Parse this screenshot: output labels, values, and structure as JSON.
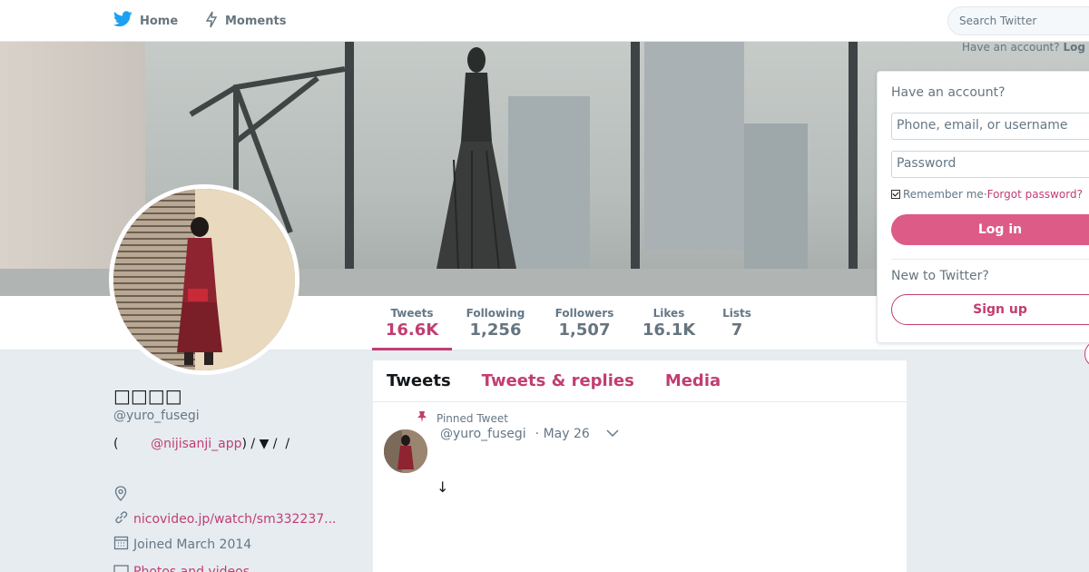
{
  "nav": {
    "home_label": "Home",
    "moments_label": "Moments",
    "search_placeholder": "Search Twitter",
    "have_account_text": "Have an account?",
    "login_link": "Log"
  },
  "profile": {
    "name": "□□□□",
    "handle": "@yuro_fusegi",
    "bio_prefix": "(        ",
    "bio_mention": "@nijisanji_app",
    "bio_suffix": ") / ▼ /  /",
    "location": "",
    "url": "nicovideo.jp/watch/sm332237...",
    "joined": "Joined March 2014",
    "photos_videos": "Photos and videos"
  },
  "stats": [
    {
      "label": "Tweets",
      "value": "16.6K"
    },
    {
      "label": "Following",
      "value": "1,256"
    },
    {
      "label": "Followers",
      "value": "1,507"
    },
    {
      "label": "Likes",
      "value": "16.1K"
    },
    {
      "label": "Lists",
      "value": "7"
    }
  ],
  "timeline": {
    "tabs": [
      "Tweets",
      "Tweets & replies",
      "Media"
    ],
    "pinned_label": "Pinned Tweet",
    "tweet": {
      "handle": "@yuro_fusegi",
      "date": "· May 26",
      "body": "↓"
    }
  },
  "login": {
    "title": "Have an account?",
    "username_placeholder": "Phone, email, or username",
    "password_placeholder": "Password",
    "remember_label": "Remember me",
    "separator": " · ",
    "forgot_label": "Forgot password?",
    "login_button": "Log in",
    "new_label": "New to Twitter?",
    "signup_button": "Sign up"
  },
  "colors": {
    "accent": "#c13e71",
    "login_button": "#dd5b87",
    "twitter_blue": "#1da1f2"
  }
}
